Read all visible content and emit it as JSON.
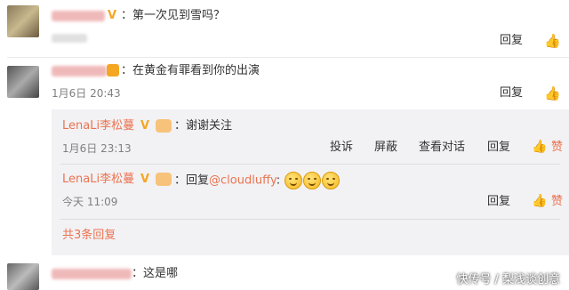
{
  "colors": {
    "accent": "#eb7350",
    "vip": "#f5a623",
    "panel": "#f2f2f5"
  },
  "c1": {
    "text": "：第一次见到雪吗？",
    "reply": "回复"
  },
  "c2": {
    "text": "：在黄金有罪看到你的出演",
    "time": "1月6日 20:43",
    "reply": "回复"
  },
  "r1": {
    "user": "LenaLi李松蔓",
    "text": "：谢谢关注",
    "time": "1月6日 23:13",
    "actions": {
      "report": "投诉",
      "block": "屏蔽",
      "view": "查看对话",
      "reply": "回复",
      "like": "赞"
    }
  },
  "r2": {
    "user": "LenaLi李松蔓",
    "prefix": "：回复",
    "mention": "@cloudluffy",
    "text": ":",
    "time": "今天 11:09",
    "reply": "回复",
    "like": "赞"
  },
  "more": {
    "text": "共3条回复"
  },
  "c3": {
    "text": "：这是哪"
  },
  "watermark": {
    "text": "快传号 / 梨浅谈创意"
  }
}
